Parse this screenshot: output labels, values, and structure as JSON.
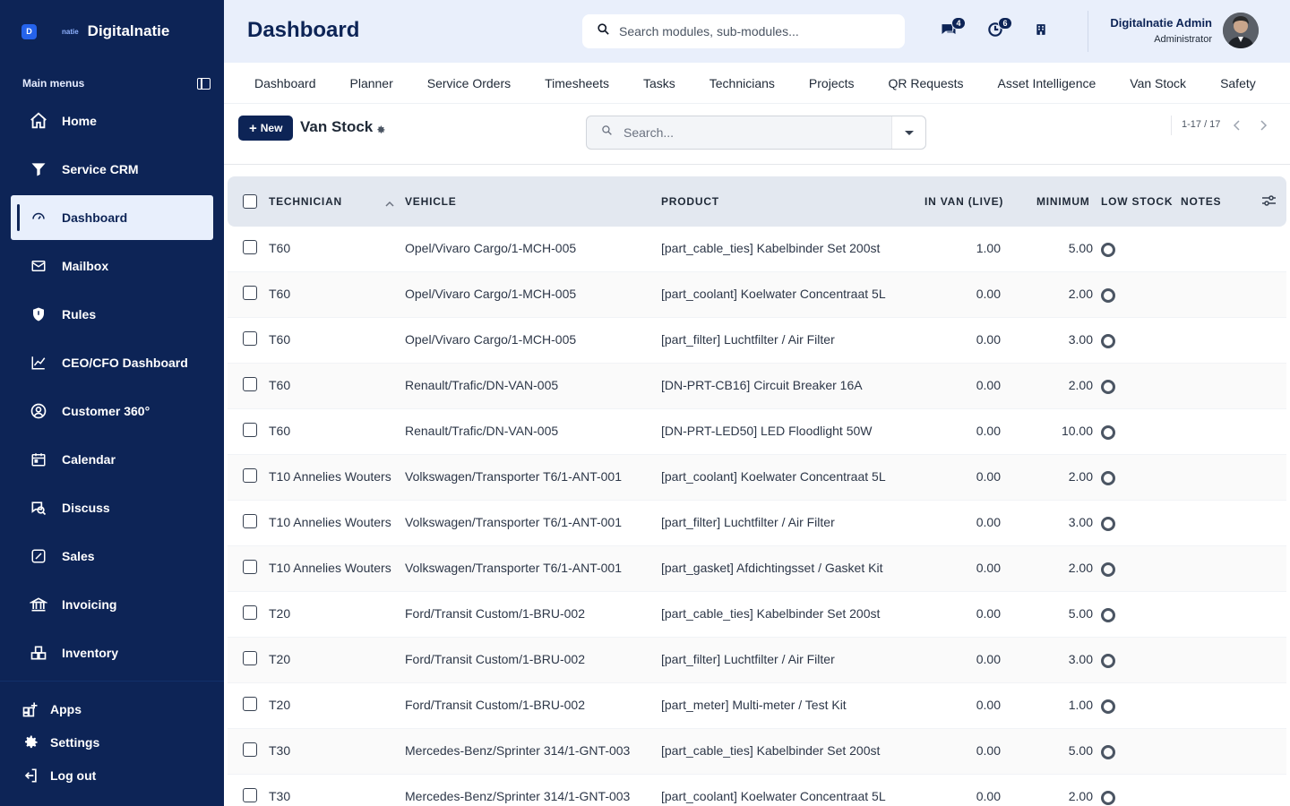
{
  "brand": {
    "logo_letter": "D",
    "small_label": "natie",
    "name": "Digitalnatie"
  },
  "sidebar": {
    "section_label": "Main menus",
    "items": [
      {
        "label": "Home",
        "icon": "home-icon"
      },
      {
        "label": "Service CRM",
        "icon": "filter-icon"
      },
      {
        "label": "Dashboard",
        "icon": "gauge-icon",
        "active": true
      },
      {
        "label": "Mailbox",
        "icon": "mail-icon"
      },
      {
        "label": "Rules",
        "icon": "shield-icon"
      },
      {
        "label": "CEO/CFO Dashboard",
        "icon": "chart-line-icon"
      },
      {
        "label": "Customer 360°",
        "icon": "user-circle-icon"
      },
      {
        "label": "Calendar",
        "icon": "calendar-icon"
      },
      {
        "label": "Discuss",
        "icon": "discuss-icon"
      },
      {
        "label": "Sales",
        "icon": "sales-icon"
      },
      {
        "label": "Invoicing",
        "icon": "bank-icon"
      },
      {
        "label": "Inventory",
        "icon": "inventory-icon"
      }
    ],
    "bottom": [
      {
        "label": "Apps",
        "icon": "apps-icon"
      },
      {
        "label": "Settings",
        "icon": "gear-icon"
      },
      {
        "label": "Log out",
        "icon": "logout-icon"
      }
    ]
  },
  "header": {
    "title": "Dashboard",
    "search_placeholder": "Search modules, sub-modules...",
    "messages_count": "4",
    "activities_count": "6",
    "user_name": "Digitalnatie Admin",
    "user_role": "Administrator"
  },
  "tabs": [
    "Dashboard",
    "Planner",
    "Service Orders",
    "Timesheets",
    "Tasks",
    "Technicians",
    "Projects",
    "QR Requests",
    "Asset Intelligence",
    "Van Stock",
    "Safety"
  ],
  "control": {
    "new_label": "New",
    "view_title": "Van Stock",
    "search_placeholder": "Search...",
    "pager": "1-17 / 17"
  },
  "table": {
    "columns": {
      "technician": "TECHNICIAN",
      "vehicle": "VEHICLE",
      "product": "PRODUCT",
      "in_van": "IN VAN (LIVE)",
      "minimum": "MINIMUM",
      "low_stock": "LOW STOCK",
      "notes": "NOTES"
    },
    "rows": [
      {
        "technician": "T60",
        "vehicle": "Opel/Vivaro Cargo/1-MCH-005",
        "product": "[part_cable_ties] Kabelbinder Set 200st",
        "in_van": "1.00",
        "minimum": "5.00"
      },
      {
        "technician": "T60",
        "vehicle": "Opel/Vivaro Cargo/1-MCH-005",
        "product": "[part_coolant] Koelwater Concentraat 5L",
        "in_van": "0.00",
        "minimum": "2.00"
      },
      {
        "technician": "T60",
        "vehicle": "Opel/Vivaro Cargo/1-MCH-005",
        "product": "[part_filter] Luchtfilter / Air Filter",
        "in_van": "0.00",
        "minimum": "3.00"
      },
      {
        "technician": "T60",
        "vehicle": "Renault/Trafic/DN-VAN-005",
        "product": "[DN-PRT-CB16] Circuit Breaker 16A",
        "in_van": "0.00",
        "minimum": "2.00"
      },
      {
        "technician": "T60",
        "vehicle": "Renault/Trafic/DN-VAN-005",
        "product": "[DN-PRT-LED50] LED Floodlight 50W",
        "in_van": "0.00",
        "minimum": "10.00"
      },
      {
        "technician": "T10 Annelies Wouters",
        "vehicle": "Volkswagen/Transporter T6/1-ANT-001",
        "product": "[part_coolant] Koelwater Concentraat 5L",
        "in_van": "0.00",
        "minimum": "2.00"
      },
      {
        "technician": "T10 Annelies Wouters",
        "vehicle": "Volkswagen/Transporter T6/1-ANT-001",
        "product": "[part_filter] Luchtfilter / Air Filter",
        "in_van": "0.00",
        "minimum": "3.00"
      },
      {
        "technician": "T10 Annelies Wouters",
        "vehicle": "Volkswagen/Transporter T6/1-ANT-001",
        "product": "[part_gasket] Afdichtingsset / Gasket Kit",
        "in_van": "0.00",
        "minimum": "2.00"
      },
      {
        "technician": "T20",
        "vehicle": "Ford/Transit Custom/1-BRU-002",
        "product": "[part_cable_ties] Kabelbinder Set 200st",
        "in_van": "0.00",
        "minimum": "5.00"
      },
      {
        "technician": "T20",
        "vehicle": "Ford/Transit Custom/1-BRU-002",
        "product": "[part_filter] Luchtfilter / Air Filter",
        "in_van": "0.00",
        "minimum": "3.00"
      },
      {
        "technician": "T20",
        "vehicle": "Ford/Transit Custom/1-BRU-002",
        "product": "[part_meter] Multi-meter / Test Kit",
        "in_van": "0.00",
        "minimum": "1.00"
      },
      {
        "technician": "T30",
        "vehicle": "Mercedes-Benz/Sprinter 314/1-GNT-003",
        "product": "[part_cable_ties] Kabelbinder Set 200st",
        "in_van": "0.00",
        "minimum": "5.00"
      },
      {
        "technician": "T30",
        "vehicle": "Mercedes-Benz/Sprinter 314/1-GNT-003",
        "product": "[part_coolant] Koelwater Concentraat 5L",
        "in_van": "0.00",
        "minimum": "2.00"
      }
    ]
  },
  "colors": {
    "sidebar_bg": "#0d2456",
    "header_bg": "#e9effb",
    "accent": "#0d2456"
  }
}
